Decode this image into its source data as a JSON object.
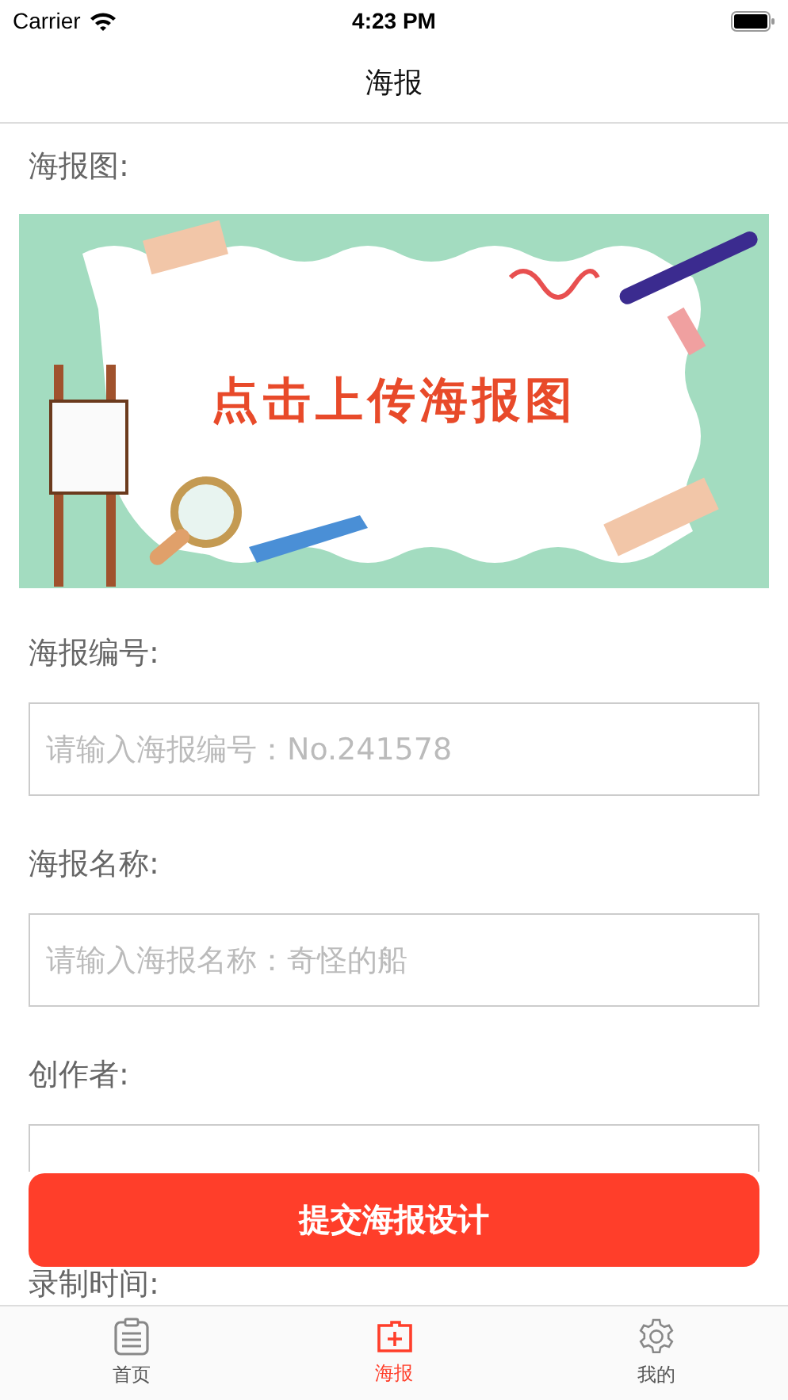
{
  "status_bar": {
    "carrier": "Carrier",
    "time": "4:23 PM"
  },
  "nav": {
    "title": "海报"
  },
  "poster": {
    "label": "海报图:",
    "banner_text": "点击上传海报图"
  },
  "fields": [
    {
      "label": "海报编号:",
      "placeholder": "请输入海报编号：No.241578"
    },
    {
      "label": "海报名称:",
      "placeholder": "请输入海报名称：奇怪的船"
    },
    {
      "label": "创作者:"
    }
  ],
  "next_label": "录制时间:",
  "submit": "提交海报设计",
  "tabs": [
    {
      "label": "首页",
      "kind": "clipboard",
      "selected": false
    },
    {
      "label": "海报",
      "kind": "poster",
      "selected": true
    },
    {
      "label": "我的",
      "kind": "gear",
      "selected": false
    }
  ]
}
